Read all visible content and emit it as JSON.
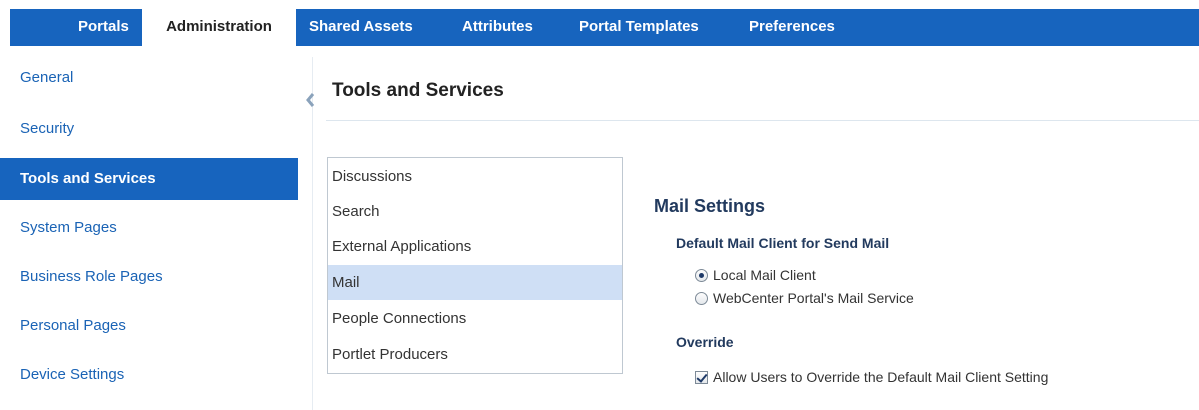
{
  "tabs": [
    {
      "label": "Portals",
      "active": false
    },
    {
      "label": "Administration",
      "active": true
    },
    {
      "label": "Shared Assets",
      "active": false
    },
    {
      "label": "Attributes",
      "active": false
    },
    {
      "label": "Portal Templates",
      "active": false
    },
    {
      "label": "Preferences",
      "active": false
    }
  ],
  "sidebar": {
    "items": [
      {
        "label": "General"
      },
      {
        "label": "Security"
      },
      {
        "label": "Tools and Services",
        "active": true
      },
      {
        "label": "System Pages"
      },
      {
        "label": "Business Role Pages"
      },
      {
        "label": "Personal Pages"
      },
      {
        "label": "Device Settings"
      }
    ]
  },
  "collapse_icon": "chevron-left-icon",
  "main": {
    "title": "Tools and Services",
    "services": [
      {
        "label": "Discussions"
      },
      {
        "label": "Search"
      },
      {
        "label": "External Applications"
      },
      {
        "label": "Mail",
        "selected": true
      },
      {
        "label": "People Connections"
      },
      {
        "label": "Portlet Producers"
      }
    ],
    "mail_settings": {
      "title": "Mail Settings",
      "default_client_heading": "Default Mail Client for Send Mail",
      "options": [
        {
          "label": "Local Mail Client",
          "checked": true
        },
        {
          "label": "WebCenter Portal's Mail Service",
          "checked": false
        }
      ],
      "override_heading": "Override",
      "override_label": "Allow Users to Override the Default Mail Client Setting",
      "override_checked": true
    }
  },
  "colors": {
    "accent": "#1764be",
    "selection": "#cfdff5",
    "link": "#1a63b5"
  }
}
